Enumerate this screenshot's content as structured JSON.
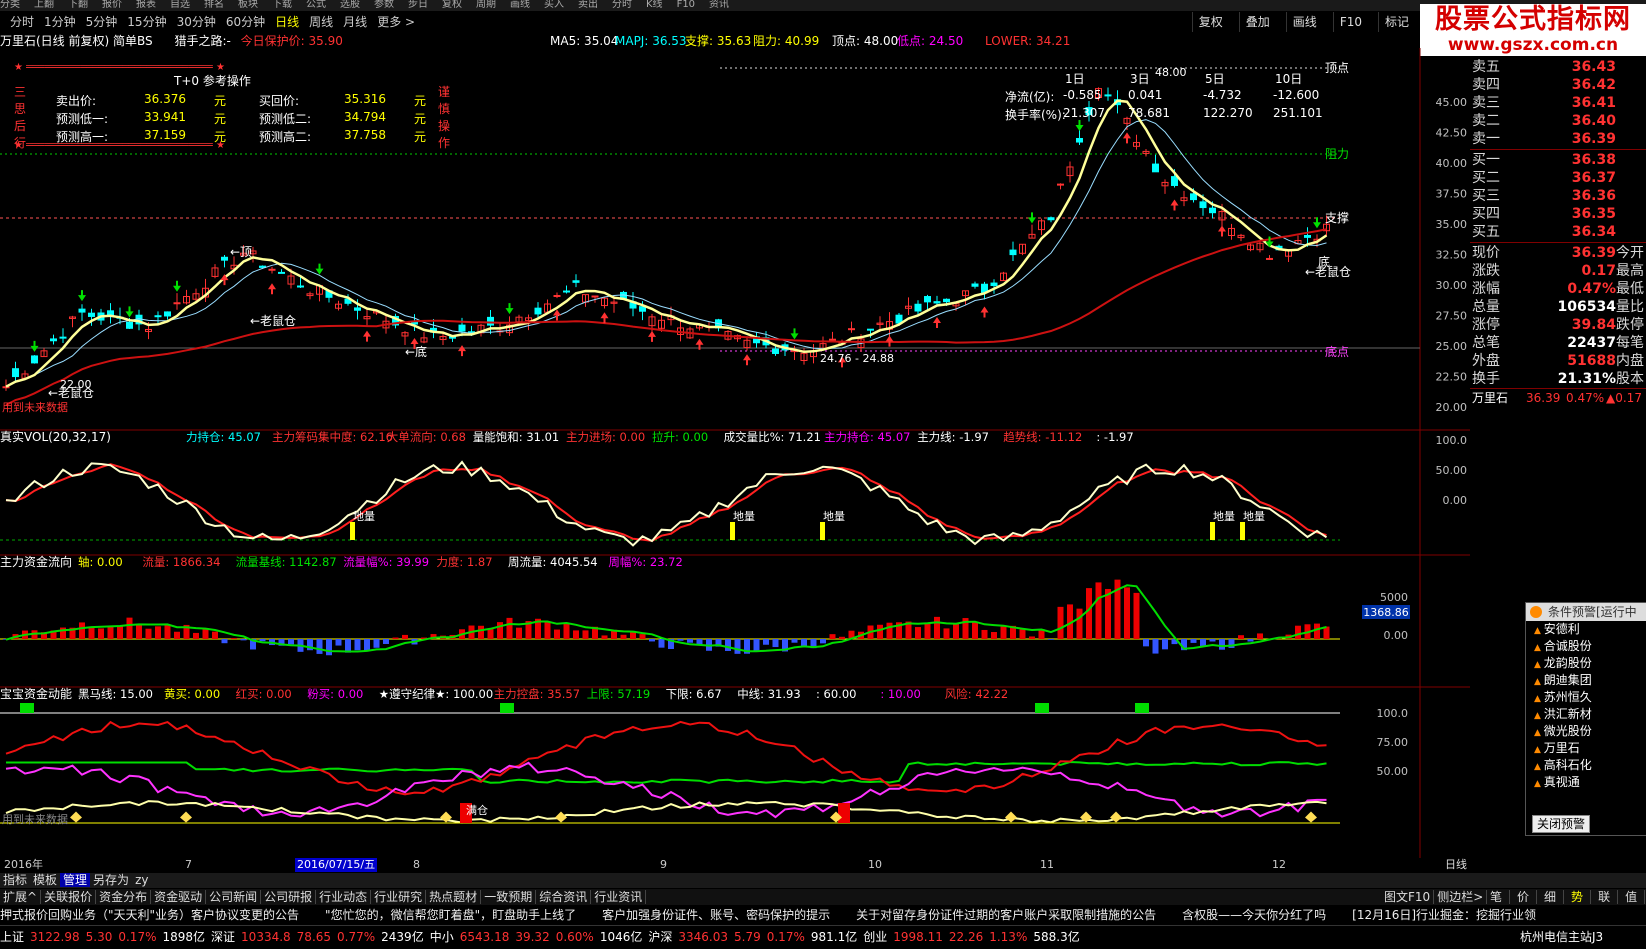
{
  "menu": [
    "分类",
    "上翻",
    "下翻",
    "报价",
    "报表",
    "自选",
    "排名",
    "板块",
    "下载",
    "公式",
    "选股",
    "参数",
    "步日",
    "复权",
    "周期",
    "画线",
    "买入",
    "卖出",
    "分时",
    "K线",
    "F10",
    "资讯"
  ],
  "periods": {
    "items": [
      "分时",
      "1分钟",
      "5分钟",
      "15分钟",
      "30分钟",
      "60分钟",
      "日线",
      "周线",
      "月线",
      "更多 >"
    ],
    "active": "日线"
  },
  "toolbar_right": [
    "复权",
    "叠加",
    "画线",
    "F10",
    "标记"
  ],
  "logo": {
    "line1": "股票公式指标网",
    "line2": "www.gszx.com.cn"
  },
  "header": {
    "stock_title": "万里石(日线 前复权) 简单BS",
    "indicator_name": "猎手之路:-",
    "protect_label": "今日保护价:",
    "protect_value": "35.90",
    "ma5": "MA5: 35.04",
    "mapj": "MAPJ: 36.53",
    "support": "支撑: 35.63",
    "resist": "阻力: 40.99",
    "top": "顶点: 48.00",
    "low": "低点: 24.50",
    "lower": "LOWER: 34.21"
  },
  "t0": {
    "title": "T+0 参考操作",
    "side_left": [
      "三",
      "思",
      "后",
      "行"
    ],
    "side_right": [
      "谨",
      "慎",
      "操",
      "作"
    ],
    "rows": [
      {
        "k1": "卖出价:",
        "v1": "36.376",
        "u1": "元",
        "k2": "买回价:",
        "v2": "35.316",
        "u2": "元"
      },
      {
        "k1": "预测低一:",
        "v1": "33.941",
        "u1": "元",
        "k2": "预测低二:",
        "v2": "34.794",
        "u2": "元"
      },
      {
        "k1": "预测高一:",
        "v1": "37.159",
        "u1": "元",
        "k2": "预测高二:",
        "v2": "37.758",
        "u2": "元"
      }
    ]
  },
  "netflow": {
    "headers": [
      "1日",
      "3日",
      "5日",
      "10日"
    ],
    "rows": [
      {
        "label": "净流(亿):",
        "values": [
          "-0.585",
          "0.041",
          "-4.732",
          "-12.600"
        ]
      },
      {
        "label": "换手率(%):",
        "values": [
          "21.307",
          "78.681",
          "122.270",
          "251.101"
        ]
      }
    ]
  },
  "chart_labels": {
    "top_line": "顶点",
    "resist_line": "阻力",
    "support_line": "支撑",
    "low_line": "底点",
    "peak_value": "48.00",
    "low_range": "24.76 - 24.88",
    "first_low": "22.00",
    "ding": "←顶",
    "lao1": "←老鼠仓",
    "lao2": "←老鼠仓",
    "lao3": "←老鼠仓",
    "di1": "←底",
    "di2": "底",
    "future": "用到未来数据",
    "future2": "用到未来数据",
    "diliang": "地量",
    "cang": "满仓"
  },
  "main_axis": [
    "45.00",
    "42.50",
    "40.00",
    "37.50",
    "35.00",
    "32.50",
    "30.00",
    "27.50",
    "25.00",
    "22.50",
    "20.00"
  ],
  "vol_panel": {
    "title": "真实VOL(20,32,17)",
    "items": [
      {
        "text": "力持仓: 45.07",
        "color": "#00ffff"
      },
      {
        "text": "主力筹码集中度: 62.16",
        "color": "#ff3232"
      },
      {
        "text": "大单流向: 0.68",
        "color": "#ff3232"
      },
      {
        "text": "量能饱和: 31.01",
        "color": "#ffffff"
      },
      {
        "text": "主力进场: 0.00",
        "color": "#ff3232"
      },
      {
        "text": "拉升: 0.00",
        "color": "#00e000"
      },
      {
        "text": "成交量比%: 71.21",
        "color": "#ffffff"
      },
      {
        "text": "主力持仓: 45.07",
        "color": "#ff00ff"
      },
      {
        "text": "主力线: -1.97",
        "color": "#ffffff"
      },
      {
        "text": "趋势线: -11.12",
        "color": "#ff3232"
      },
      {
        "text": ": -1.97",
        "color": "#ffffff"
      }
    ],
    "axis": [
      "100.0",
      "50.00",
      "0.00"
    ]
  },
  "flow_panel": {
    "title": "主力资金流向",
    "items": [
      {
        "text": "轴: 0.00",
        "color": "#ffff00"
      },
      {
        "text": "流量: 1866.34",
        "color": "#ff3232"
      },
      {
        "text": "流量基线: 1142.87",
        "color": "#00e000"
      },
      {
        "text": "流量幅%: 39.99",
        "color": "#ff00ff"
      },
      {
        "text": "力度: 1.87",
        "color": "#ff3232"
      },
      {
        "text": "周流量: 4045.54",
        "color": "#ffffff"
      },
      {
        "text": "周幅%: 23.72",
        "color": "#ff00ff"
      }
    ],
    "axis": [
      "5000",
      "0.00"
    ],
    "badge": "1368.86"
  },
  "bao_panel": {
    "title": "宝宝资金动能",
    "items": [
      {
        "text": "黑马线: 15.00",
        "color": "#ffffff"
      },
      {
        "text": "黄买: 0.00",
        "color": "#ffff00"
      },
      {
        "text": "红买: 0.00",
        "color": "#ff3232"
      },
      {
        "text": "粉买: 0.00",
        "color": "#ff00ff"
      },
      {
        "text": "★遵守纪律★: 100.00",
        "color": "#ffffff"
      },
      {
        "text": "主力控盘: 35.57",
        "color": "#ff3232"
      },
      {
        "text": "上限: 57.19",
        "color": "#00e000"
      },
      {
        "text": "下限: 6.67",
        "color": "#ffffff"
      },
      {
        "text": "中线: 31.93",
        "color": "#ffffff"
      },
      {
        "text": ": 60.00",
        "color": "#ffffff"
      },
      {
        "text": ": 10.00",
        "color": "#ff00ff"
      },
      {
        "text": "风险: 42.22",
        "color": "#ff3232"
      }
    ],
    "axis": [
      "100.0",
      "75.00",
      "50.00"
    ]
  },
  "dates": {
    "year": "2016年",
    "months": [
      "7",
      "8",
      "9",
      "10",
      "11",
      "12"
    ],
    "cursor": "2016/07/15/五",
    "period": "日线"
  },
  "orderbook": {
    "asks": [
      {
        "label": "卖五",
        "price": "36.43"
      },
      {
        "label": "卖四",
        "price": "36.42"
      },
      {
        "label": "卖三",
        "price": "36.41"
      },
      {
        "label": "卖二",
        "price": "36.40"
      },
      {
        "label": "卖一",
        "price": "36.39"
      }
    ],
    "bids": [
      {
        "label": "买一",
        "price": "36.38"
      },
      {
        "label": "买二",
        "price": "36.37"
      },
      {
        "label": "买三",
        "price": "36.36"
      },
      {
        "label": "买四",
        "price": "36.35"
      },
      {
        "label": "买五",
        "price": "36.34"
      }
    ],
    "stats": [
      {
        "k": "现价",
        "v": "36.39",
        "r": "今开",
        "color": "#ff3232"
      },
      {
        "k": "涨跌",
        "v": "0.17",
        "r": "最高",
        "color": "#ff3232"
      },
      {
        "k": "涨幅",
        "v": "0.47%",
        "r": "最低",
        "color": "#ff3232"
      },
      {
        "k": "总量",
        "v": "106534",
        "r": "量比",
        "color": "#ffffff"
      },
      {
        "k": "涨停",
        "v": "39.84",
        "r": "跌停",
        "color": "#ff3232"
      },
      {
        "k": "总笔",
        "v": "22437",
        "r": "每笔",
        "color": "#ffffff"
      },
      {
        "k": "外盘",
        "v": "51688",
        "r": "内盘",
        "color": "#ff3232"
      },
      {
        "k": "换手",
        "v": "21.31%",
        "r": "股本",
        "color": "#ffffff"
      }
    ],
    "summary": {
      "name": "万里石",
      "price": "36.39",
      "pct": "0.47%",
      "chg": "▲0.17"
    }
  },
  "alert_popup": {
    "title": "条件预警[运行中",
    "items": [
      "安德利",
      "合诚股份",
      "龙韵股份",
      "朗迪集团",
      "苏州恒久",
      "洪汇新材",
      "微光股份",
      "万里石",
      "高科石化",
      "真视通"
    ],
    "close": "关闭预警"
  },
  "tabs1": [
    "指标",
    "模板",
    "管理",
    "另存为",
    "zy"
  ],
  "tabs1_active": "管理",
  "tabs2": [
    "扩展^",
    "关联报价",
    "资金分布",
    "资金驱动",
    "公司新闻",
    "公司研报",
    "行业动态",
    "行业研究",
    "热点题材",
    "一致预期",
    "综合资讯",
    "行业资讯"
  ],
  "tabs2_right": [
    "图文F10",
    "侧边栏>"
  ],
  "tabs_far": [
    "笔",
    "价",
    "细",
    "势",
    "联",
    "值"
  ],
  "ticker": [
    "押式报价回购业务（\"天天利\"业务）客户协议变更的公告",
    "\"您忙您的，微信帮您盯着盘\"，盯盘助手上线了",
    "客户加强身份证件、账号、密码保护的提示",
    "关于对留存身份证件过期的客户账户采取限制措施的公告",
    "含权股——今天你分红了吗",
    "[12月16日]行业掘金：挖掘行业领"
  ],
  "status": [
    {
      "text": "上证",
      "color": "#ffffff"
    },
    {
      "text": "3122.98",
      "color": "#ff3232"
    },
    {
      "text": "5.30",
      "color": "#ff3232"
    },
    {
      "text": "0.17%",
      "color": "#ff3232"
    },
    {
      "text": "1898亿",
      "color": "#ffffff"
    },
    {
      "text": "深证",
      "color": "#ffffff"
    },
    {
      "text": "10334.8",
      "color": "#ff3232"
    },
    {
      "text": "78.65",
      "color": "#ff3232"
    },
    {
      "text": "0.77%",
      "color": "#ff3232"
    },
    {
      "text": "2439亿",
      "color": "#ffffff"
    },
    {
      "text": "中小",
      "color": "#ffffff"
    },
    {
      "text": "6543.18",
      "color": "#ff3232"
    },
    {
      "text": "39.32",
      "color": "#ff3232"
    },
    {
      "text": "0.60%",
      "color": "#ff3232"
    },
    {
      "text": "1046亿",
      "color": "#ffffff"
    },
    {
      "text": "沪深",
      "color": "#ffffff"
    },
    {
      "text": "3346.03",
      "color": "#ff3232"
    },
    {
      "text": "5.79",
      "color": "#ff3232"
    },
    {
      "text": "0.17%",
      "color": "#ff3232"
    },
    {
      "text": "981.1亿",
      "color": "#ffffff"
    },
    {
      "text": "创业",
      "color": "#ffffff"
    },
    {
      "text": "1998.11",
      "color": "#ff3232"
    },
    {
      "text": "22.26",
      "color": "#ff3232"
    },
    {
      "text": "1.13%",
      "color": "#ff3232"
    },
    {
      "text": "588.3亿",
      "color": "#ffffff"
    },
    {
      "text": "杭州电信主站J3",
      "color": "#ffffff"
    }
  ],
  "colors": {
    "up": "#ff3232",
    "down": "#00ffff",
    "ma_yellow": "#ffff99",
    "ma_red": "#cc1111",
    "green": "#00e000",
    "magenta": "#ff33ff",
    "orange_arrow": "#ff3232",
    "green_arrow": "#00e000"
  }
}
